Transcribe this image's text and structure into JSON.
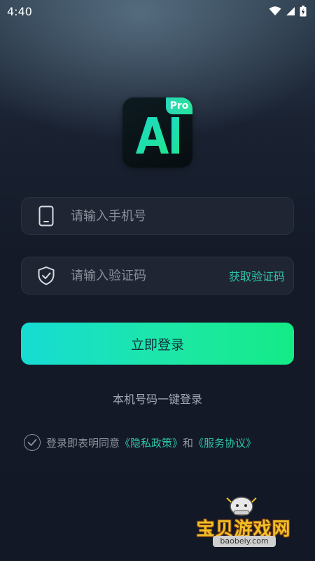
{
  "status_bar": {
    "time": "4:40",
    "icons": [
      "wifi-icon",
      "signal-icon",
      "battery-charging-icon"
    ]
  },
  "logo": {
    "main_text": "AI",
    "badge": "Pro",
    "colors": {
      "text_gradient_start": "#1bd9c9",
      "text_gradient_end": "#22e48f",
      "background": "#0b1418"
    }
  },
  "phone_field": {
    "icon": "phone-icon",
    "placeholder": "请输入手机号",
    "value": ""
  },
  "code_field": {
    "icon": "shield-check-icon",
    "placeholder": "请输入验证码",
    "value": "",
    "get_code_label": "获取验证码"
  },
  "login_button": {
    "label": "立即登录",
    "colors": {
      "gradient_start": "#16dcd3",
      "gradient_end": "#14eb86"
    }
  },
  "one_key_login": "本机号码一键登录",
  "agreement": {
    "checked": false,
    "prefix": "登录即表明同意",
    "privacy_link": "《隐私政策》",
    "and": "和",
    "service_link": "《服务协议》"
  },
  "watermark": {
    "title": "宝贝游戏网",
    "url": "baobeiy.com"
  }
}
